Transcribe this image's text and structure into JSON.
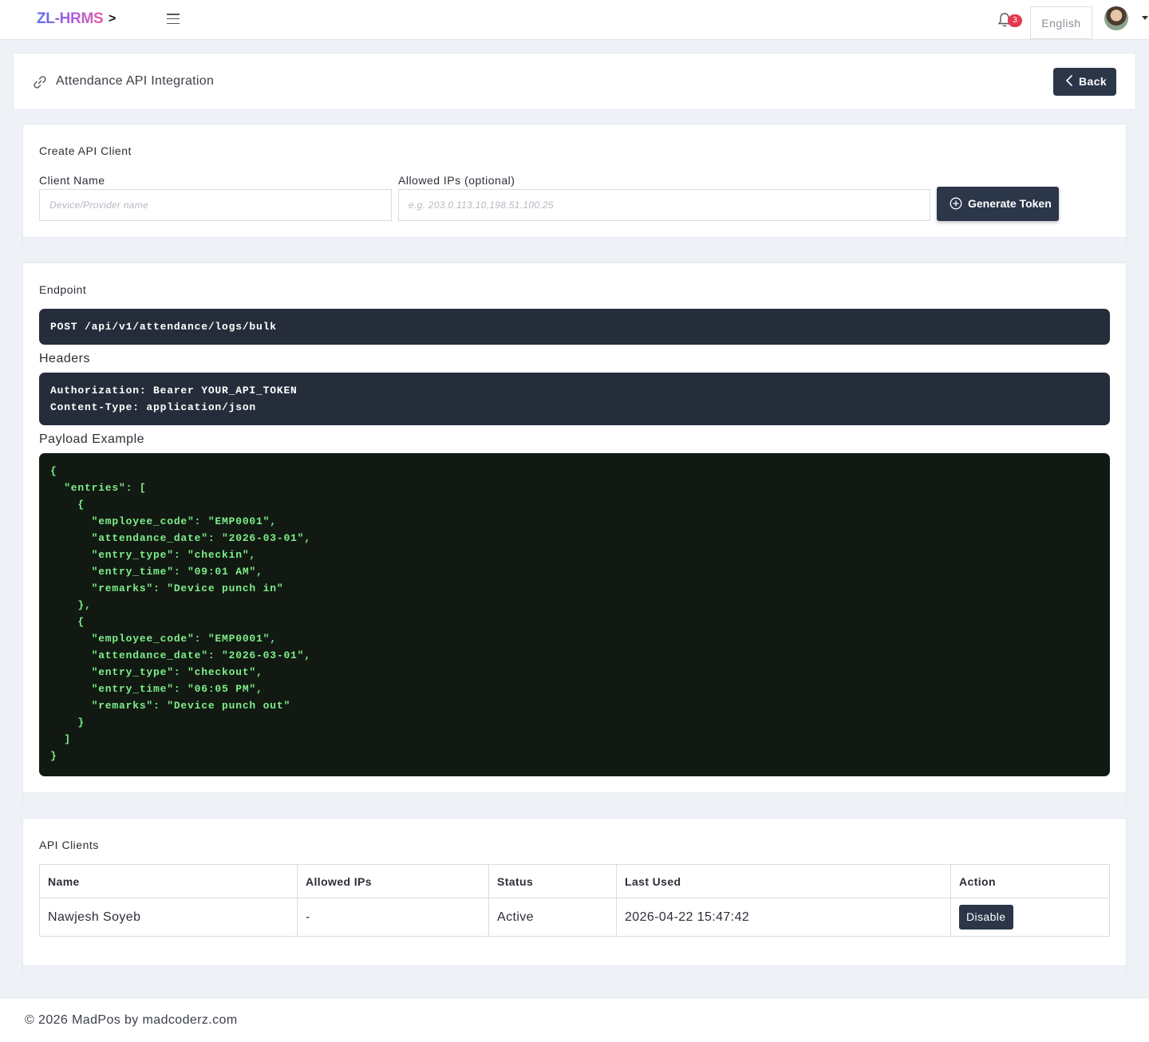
{
  "topbar": {
    "brand": "ZL-HRMS",
    "brand_caret": ">",
    "notification_count": "3",
    "language": "English"
  },
  "page": {
    "title": "Attendance API Integration",
    "back_label": "Back"
  },
  "create_client": {
    "heading": "Create API Client",
    "client_name_label": "Client Name",
    "client_name_placeholder": "Device/Provider name",
    "allowed_ips_label": "Allowed IPs (optional)",
    "allowed_ips_placeholder": "e.g. 203.0.113.10,198.51.100.25",
    "generate_label": "Generate Token"
  },
  "docs": {
    "endpoint_heading": "Endpoint",
    "endpoint": "POST /api/v1/attendance/logs/bulk",
    "headers_heading": "Headers",
    "headers_lines": [
      "Authorization: Bearer YOUR_API_TOKEN",
      "Content-Type: application/json"
    ],
    "payload_heading": "Payload Example",
    "payload_lines": [
      "{",
      "  \"entries\": [",
      "    {",
      "      \"employee_code\": \"EMP0001\",",
      "      \"attendance_date\": \"2026-03-01\",",
      "      \"entry_type\": \"checkin\",",
      "      \"entry_time\": \"09:01 AM\",",
      "      \"remarks\": \"Device punch in\"",
      "    },",
      "    {",
      "      \"employee_code\": \"EMP0001\",",
      "      \"attendance_date\": \"2026-03-01\",",
      "      \"entry_type\": \"checkout\",",
      "      \"entry_time\": \"06:05 PM\",",
      "      \"remarks\": \"Device punch out\"",
      "    }",
      "  ]",
      "}"
    ]
  },
  "clients": {
    "heading": "API Clients",
    "columns": [
      "Name",
      "Allowed IPs",
      "Status",
      "Last Used",
      "Action"
    ],
    "rows": [
      {
        "name": "Nawjesh Soyeb",
        "allowed_ips": "-",
        "status": "Active",
        "last_used": "2026-04-22 15:47:42",
        "action": "Disable"
      }
    ]
  },
  "footer": {
    "text": "© 2026 MadPos by madcoderz.com"
  }
}
